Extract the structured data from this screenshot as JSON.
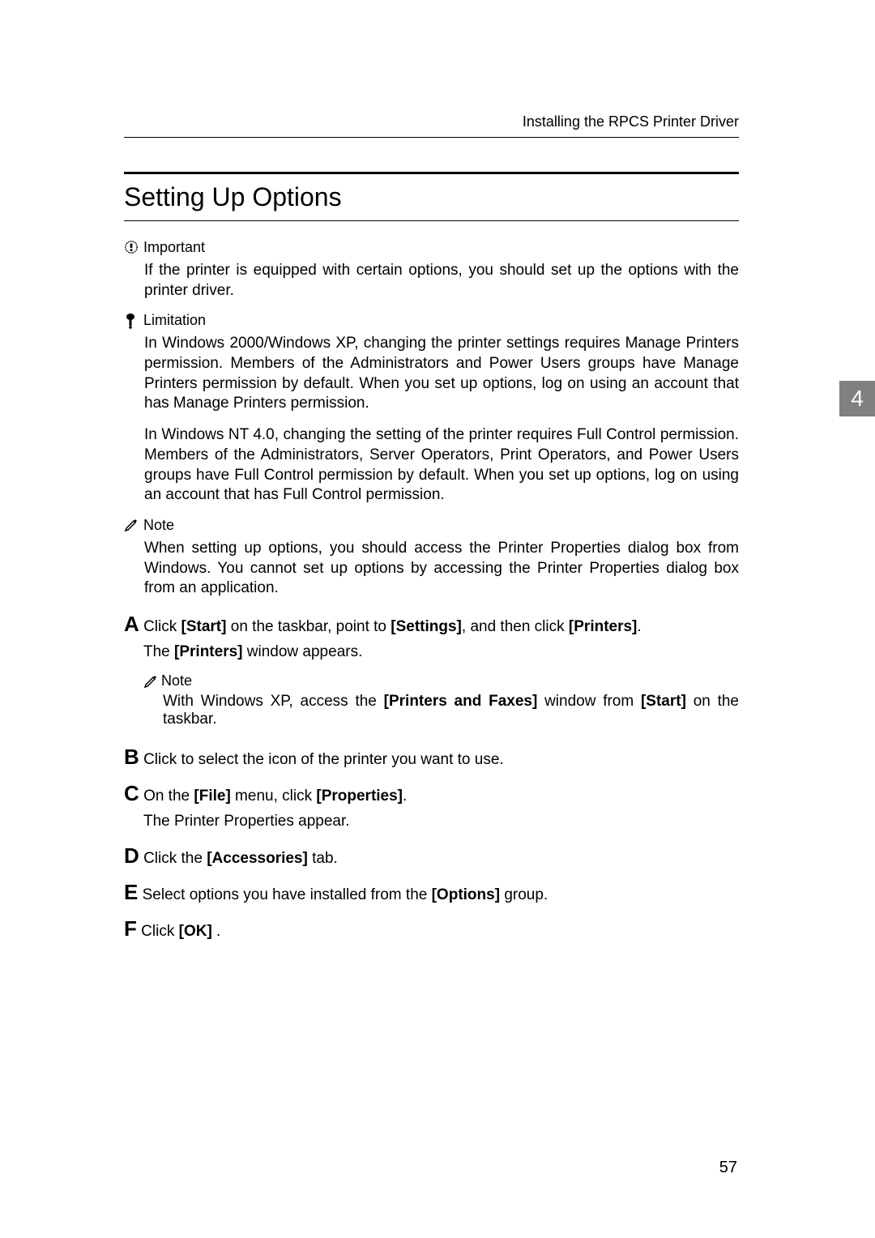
{
  "header": {
    "breadcrumb": "Installing the RPCS Printer Driver"
  },
  "section": {
    "title": "Setting Up Options"
  },
  "important": {
    "label": "Important",
    "text": "If the printer is equipped with certain options, you should set up the options with the printer driver."
  },
  "limitation": {
    "label": "Limitation",
    "items": [
      "In Windows 2000/Windows XP, changing the printer settings requires Manage Printers permission. Members of the Administrators and Power Users groups have Manage Printers permission by default. When you set up options, log on using an account that has Manage Printers permission.",
      "In Windows NT 4.0, changing the setting of the printer requires Full Control permission. Members of the Administrators, Server Operators, Print Operators, and Power Users groups have Full Control permission by default. When you set up options, log on using an account that has Full Control permission."
    ]
  },
  "note1": {
    "label": "Note",
    "text": "When setting up options, you should access the Printer Properties dialog box from Windows. You cannot set up options by accessing the Printer Properties dialog box from an application."
  },
  "steps": {
    "a": {
      "letter": "A",
      "prefix": "Click ",
      "b1": "[Start]",
      "mid1": " on the taskbar, point to ",
      "b2": "[Settings]",
      "mid2": ", and then click ",
      "b3": "[Printers]",
      "suffix": ".",
      "sub_prefix": "The ",
      "sub_bold": "[Printers]",
      "sub_suffix": " window appears.",
      "note_label": "Note",
      "note_prefix": "With Windows XP, access the ",
      "note_b1": "[Printers and Faxes]",
      "note_mid": " window from  ",
      "note_b2": "[Start]",
      "note_suffix": " on the taskbar."
    },
    "b": {
      "letter": "B",
      "text": "Click to select the icon of the printer you want to use."
    },
    "c": {
      "letter": "C",
      "prefix": "On the ",
      "b1": "[File]",
      "mid": " menu, click ",
      "b2": "[Properties]",
      "suffix": ".",
      "sub": "The Printer Properties appear."
    },
    "d": {
      "letter": "D",
      "prefix": "Click the ",
      "b1": "[Accessories]",
      "suffix": " tab."
    },
    "e": {
      "letter": "E",
      "prefix": "Select options you have installed from the  ",
      "b1": "[Options]",
      "suffix": " group."
    },
    "f": {
      "letter": "F",
      "prefix": "Click ",
      "b1": "[OK]",
      "suffix": " ."
    }
  },
  "chapter": {
    "number": "4"
  },
  "page": {
    "number": "57"
  }
}
